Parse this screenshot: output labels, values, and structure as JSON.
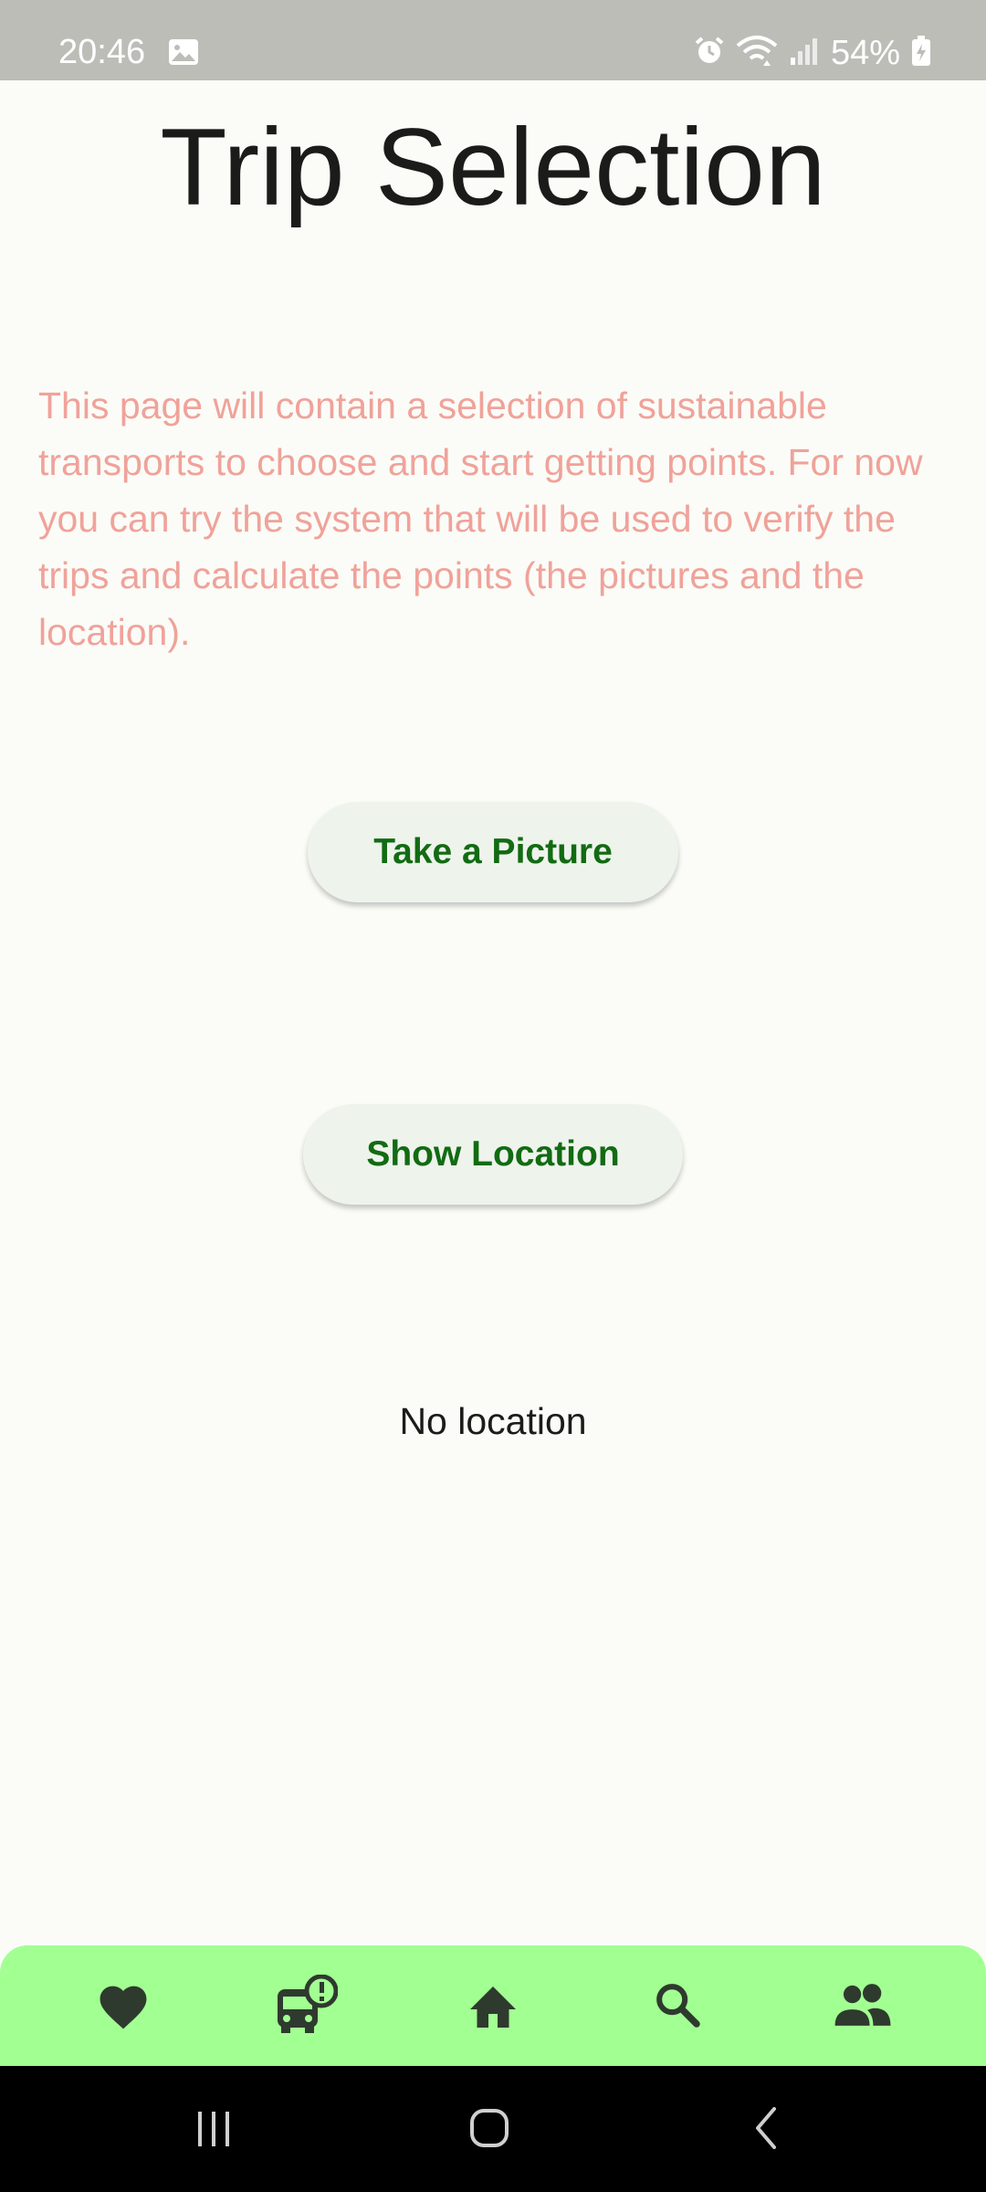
{
  "status_bar": {
    "time": "20:46",
    "battery_text": "54%",
    "icons": [
      "gallery-icon",
      "alarm-icon",
      "wifi-icon",
      "signal-icon",
      "battery-charging-icon"
    ]
  },
  "page": {
    "title": "Trip Selection",
    "description": "This page will contain a selection of sustainable transports to choose and start getting points. For now you can try the system that will be used to verify the trips and calculate the points (the pictures and the location).",
    "take_picture_label": "Take a Picture",
    "show_location_label": "Show Location",
    "location_status": "No location"
  },
  "bottom_nav": {
    "items": [
      {
        "icon": "heart-icon"
      },
      {
        "icon": "bus-alert-icon"
      },
      {
        "icon": "home-icon"
      },
      {
        "icon": "search-icon"
      },
      {
        "icon": "people-icon"
      }
    ]
  },
  "system_nav": {
    "buttons": [
      "recent-apps-icon",
      "home-circle-icon",
      "back-icon"
    ]
  },
  "colors": {
    "background": "#fbfcf7",
    "description_text": "#f0a29a",
    "button_text": "#126b12",
    "button_bg": "#eef3ec",
    "bottom_nav_bg": "#a2ff92",
    "nav_icon": "#2e3a2e"
  }
}
